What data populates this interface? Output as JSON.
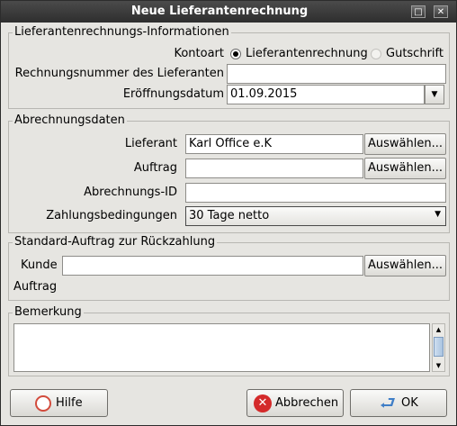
{
  "window": {
    "title": "Neue Lieferantenrechnung",
    "minimize_glyph": "□",
    "close_glyph": "✕"
  },
  "invoice_info": {
    "group_label": "Lieferantenrechnungs-Informationen",
    "kontoart_label": "Kontoart",
    "radio_options": [
      "Lieferantenrechnung",
      "Gutschrift"
    ],
    "selected_option": "Lieferantenrechnung",
    "rechnungsnummer_label": "Rechnungsnummer des Lieferanten",
    "rechnungsnummer_value": "",
    "eroeffnungsdatum_label": "Eröffnungsdatum",
    "eroeffnungsdatum_value": "01.09.2015"
  },
  "billing": {
    "group_label": "Abrechnungsdaten",
    "lieferant_label": "Lieferant",
    "lieferant_value": "Karl Office e.K",
    "auftrag_label": "Auftrag",
    "auftrag_value": "",
    "abrechnungs_id_label": "Abrechnungs-ID",
    "abrechnungs_id_value": "",
    "zahlungsbedingungen_label": "Zahlungsbedingungen",
    "zahlungsbedingungen_value": "30 Tage netto",
    "select_button_label": "Auswählen..."
  },
  "refund": {
    "group_label": "Standard-Auftrag zur Rückzahlung",
    "kunde_label": "Kunde",
    "kunde_value": "",
    "auftrag_label": "Auftrag"
  },
  "remark": {
    "group_label": "Bemerkung",
    "value": ""
  },
  "buttons": {
    "help": "Hilfe",
    "cancel": "Abbrechen",
    "ok": "OK"
  },
  "colors": {
    "titlebar": "#3a3a3a",
    "window_bg": "#e6e5e1",
    "cancel_icon": "#d42a2a",
    "ok_icon": "#3f7ec7"
  }
}
